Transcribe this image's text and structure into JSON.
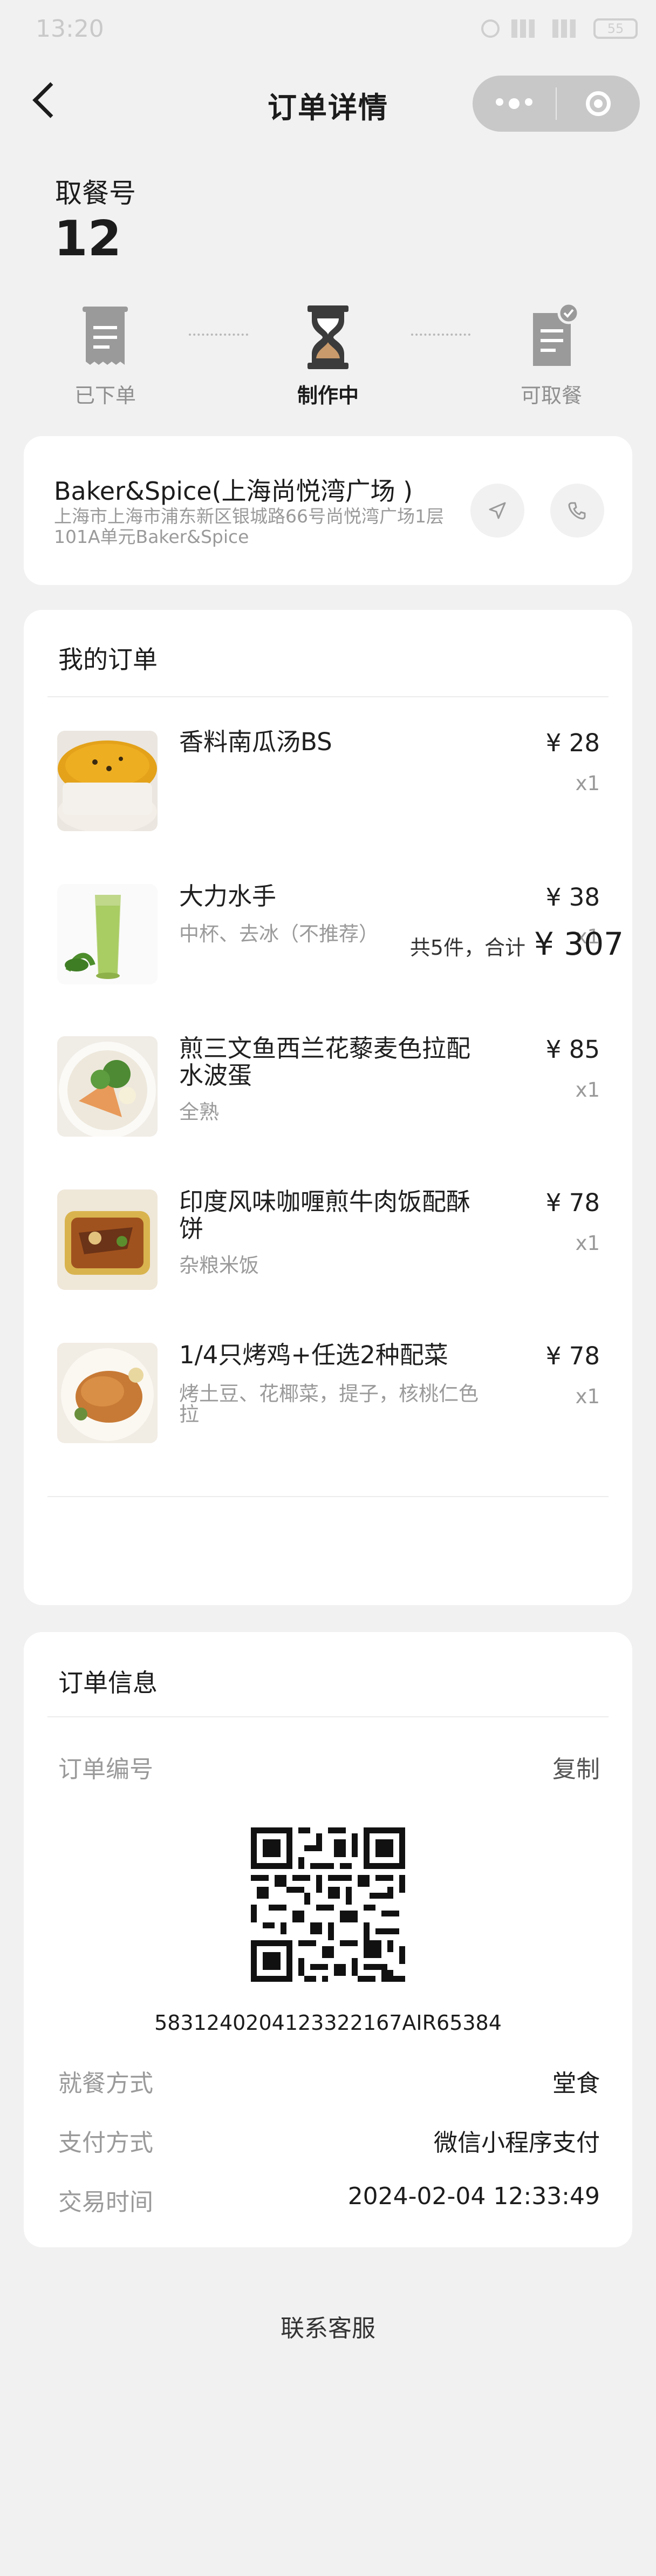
{
  "status_bar": {
    "time": "13:20",
    "battery": "55"
  },
  "nav": {
    "title": "订单详情"
  },
  "pickup": {
    "label": "取餐号",
    "number": "12"
  },
  "progress": {
    "steps": [
      {
        "label": "已下单",
        "icon": "receipt-icon",
        "active": false
      },
      {
        "label": "制作中",
        "icon": "hourglass-icon",
        "active": true
      },
      {
        "label": "可取餐",
        "icon": "document-check-icon",
        "active": false
      }
    ]
  },
  "store": {
    "name": "Baker&Spice(上海尚悦湾广场 )",
    "address": "上海市上海市浦东新区银城路66号尚悦湾广场1层101A单元Baker&Spice"
  },
  "order": {
    "title": "我的订单",
    "items": [
      {
        "name": "香料南瓜汤BS",
        "spec": "",
        "price": "¥ 28",
        "qty": "x1"
      },
      {
        "name": "大力水手",
        "spec": "中杯、去冰（不推荐）",
        "price": "¥ 38",
        "qty": "x1"
      },
      {
        "name": "煎三文鱼西兰花藜麦色拉配水波蛋",
        "spec": "全熟",
        "price": "¥ 85",
        "qty": "x1"
      },
      {
        "name": "印度风味咖喱煎牛肉饭配酥饼",
        "spec": "杂粮米饭",
        "price": "¥ 78",
        "qty": "x1"
      },
      {
        "name": "1/4只烤鸡+任选2种配菜",
        "spec": "烤土豆、花椰菜，提子，核桃仁色拉",
        "price": "¥ 78",
        "qty": "x1"
      }
    ],
    "total_label": "共5件，合计",
    "total_value": "¥ 307"
  },
  "info": {
    "title": "订单信息",
    "order_no_label": "订单编号",
    "copy_label": "复制",
    "order_no": "5831240204123322167AIR65384",
    "dining_label": "就餐方式",
    "dining_value": "堂食",
    "payment_label": "支付方式",
    "payment_value": "微信小程序支付",
    "time_label": "交易时间",
    "time_value": "2024-02-04 12:33:49"
  },
  "footer": {
    "support": "联系客服"
  }
}
